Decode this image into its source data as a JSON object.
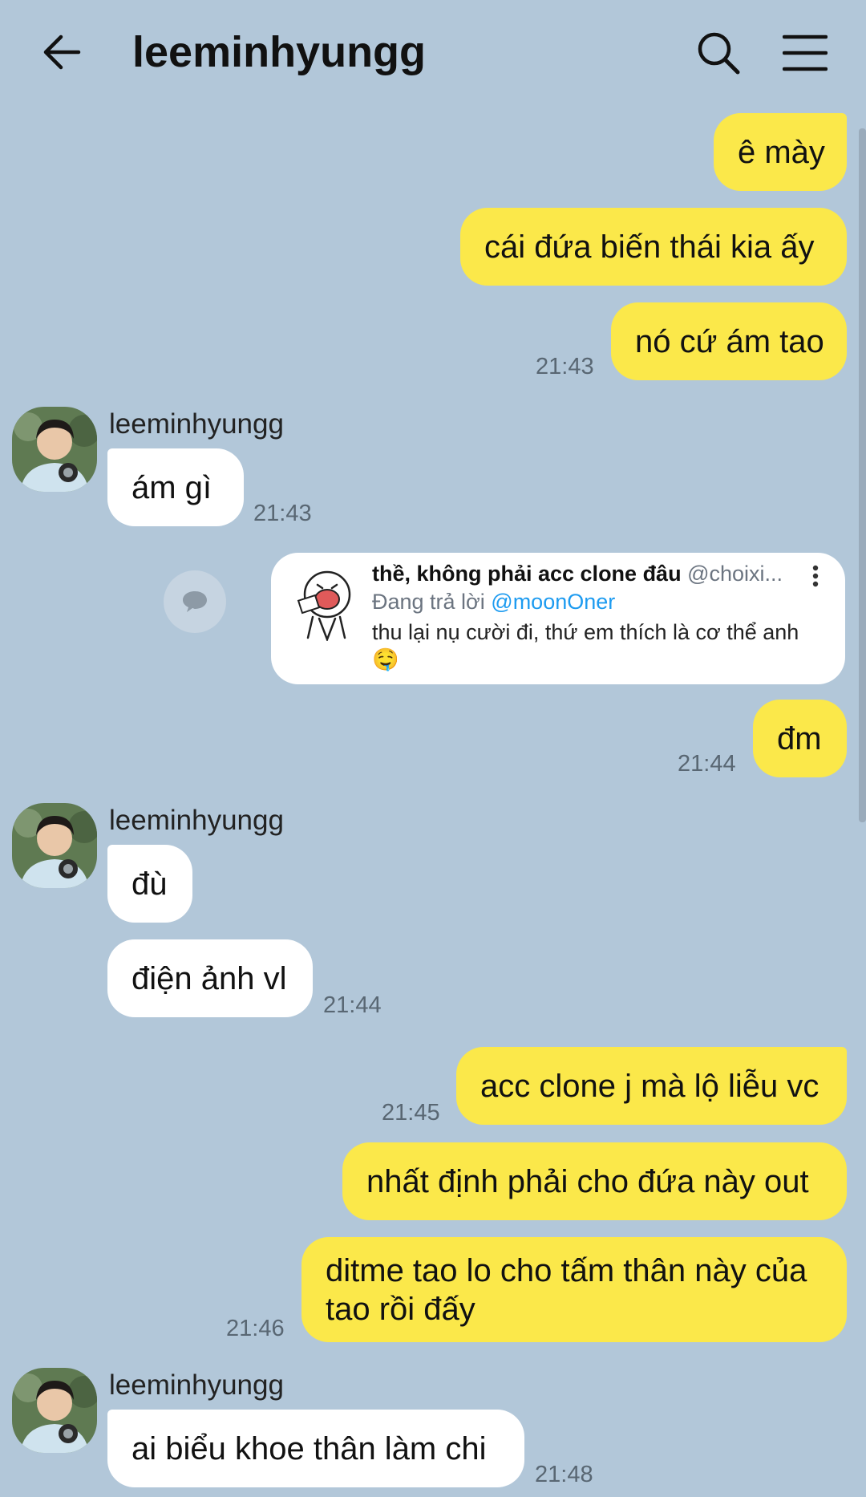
{
  "header": {
    "title": "leeminhyungg"
  },
  "contact": {
    "name": "leeminhyungg"
  },
  "messages": {
    "m1": "ê mày",
    "m2": "cái đứa biến thái kia ấy",
    "m3": "nó cứ ám tao",
    "t1": "21:43",
    "r1": "ám gì",
    "t2": "21:43",
    "m4": "đm",
    "t3": "21:44",
    "r2": "đù",
    "r3": "điện ảnh vl",
    "t4": "21:44",
    "m5": "acc clone j mà lộ liễu vc",
    "t5": "21:45",
    "m6": "nhất định phải cho đứa này out",
    "m7": "ditme tao lo cho tấm thân này của tao rồi đấy",
    "t6": "21:46",
    "r4": "ai biểu khoe thân làm chi",
    "t7": "21:48"
  },
  "shared_post": {
    "author_name": "thề, không phải acc clone đâu",
    "author_handle": "@choixi...",
    "reply_prefix": "Đang trả lời",
    "reply_mention": "@moonOner",
    "text": "thu lại nụ cười đi, thứ em thích là cơ thể anh",
    "emoji": "🤤"
  },
  "colors": {
    "background": "#b2c7d9",
    "outgoing_bubble": "#fbe84a",
    "incoming_bubble": "#ffffff",
    "mention": "#1d9bf0"
  }
}
